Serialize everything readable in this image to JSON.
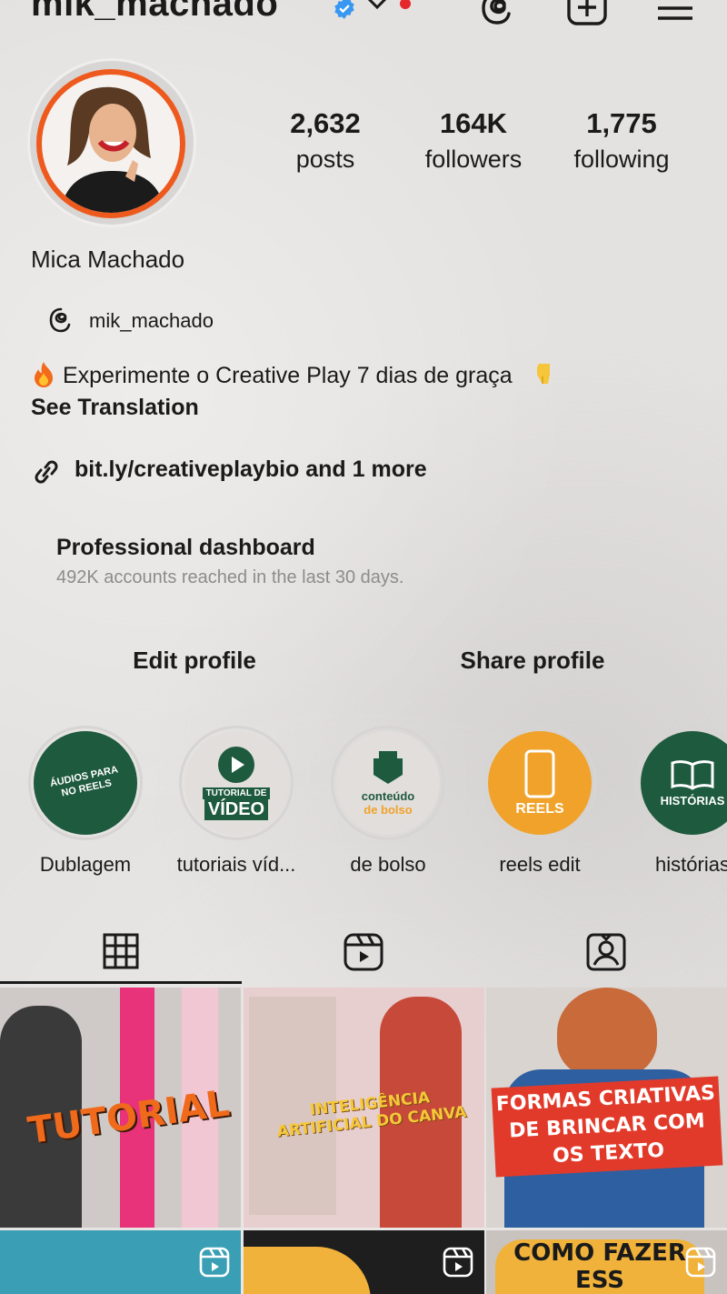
{
  "header": {
    "username": "mik_machado"
  },
  "stats": {
    "posts_num": "2,632",
    "posts_label": "posts",
    "followers_num": "164K",
    "followers_label": "followers",
    "following_num": "1,775",
    "following_label": "following"
  },
  "profile": {
    "display_name": "Mica Machado",
    "threads_handle": "mik_machado",
    "bio": "Experimente o Creative Play 7 dias de graça",
    "see_translation": "See Translation",
    "link": "bit.ly/creativeplaybio and 1 more"
  },
  "dashboard": {
    "title": "Professional dashboard",
    "subtitle": "492K accounts reached in the last 30 days."
  },
  "buttons": {
    "edit_profile": "Edit profile",
    "share_profile": "Share profile"
  },
  "highlights": [
    {
      "label": "Dublagem",
      "art": "ÁUDIOS PARA NO REELS",
      "color": "#1e5a3e"
    },
    {
      "label": "tutoriais víd...",
      "art1": "TUTORIAL DE",
      "art2": "VÍDEO",
      "color": "#e2dedc"
    },
    {
      "label": "de bolso",
      "art1": "conteúdo",
      "art2": "de bolso",
      "color": "#e2dedc"
    },
    {
      "label": "reels edit",
      "art": "REELS",
      "color": "#f0a22a"
    },
    {
      "label": "histórias",
      "art": "HISTÓRIAS",
      "color": "#1e5a3e"
    }
  ],
  "posts": [
    {
      "title": "TUTORIAL"
    },
    {
      "title": "INTELIGÊNCIA ARTIFICIAL DO CANVA"
    },
    {
      "title": "FORMAS CRIATIVAS DE BRINCAR COM OS TEXTO"
    },
    {
      "title": ""
    },
    {
      "title": ""
    },
    {
      "title": "COMO FAZER ESS"
    }
  ],
  "colors": {
    "verified": "#3897f0",
    "notification": "#e5262a",
    "highlight_green": "#1e5a3e",
    "highlight_orange": "#f0a22a"
  }
}
